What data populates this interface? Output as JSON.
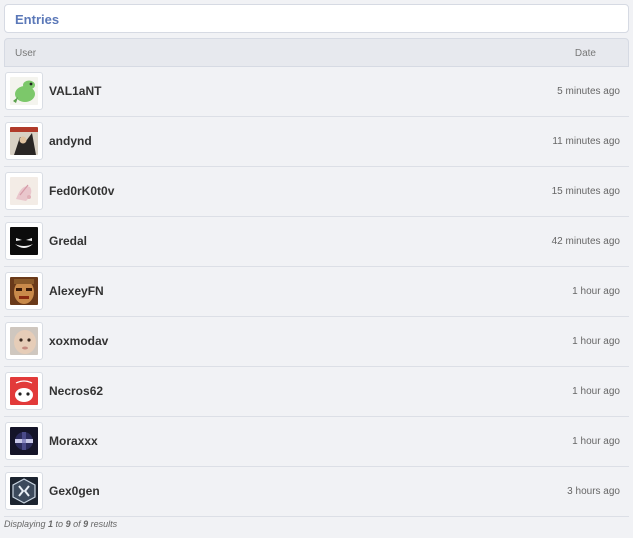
{
  "header": {
    "title": "Entries"
  },
  "table": {
    "columns": {
      "user": "User",
      "date": "Date"
    },
    "rows": [
      {
        "user": "VAL1aNT",
        "time": "5 minutes ago",
        "avatar": "green-creature-avatar"
      },
      {
        "user": "andynd",
        "time": "11 minutes ago",
        "avatar": "dark-comic-avatar"
      },
      {
        "user": "Fed0rK0t0v",
        "time": "15 minutes ago",
        "avatar": "pale-drawing-avatar"
      },
      {
        "user": "Gredal",
        "time": "42 minutes ago",
        "avatar": "grin-face-avatar"
      },
      {
        "user": "AlexeyFN",
        "time": "1 hour ago",
        "avatar": "doom-face-avatar"
      },
      {
        "user": "xoxmodav",
        "time": "1 hour ago",
        "avatar": "baby-photo-avatar"
      },
      {
        "user": "Necros62",
        "time": "1 hour ago",
        "avatar": "red-cartoon-avatar"
      },
      {
        "user": "Moraxxx",
        "time": "1 hour ago",
        "avatar": "dark-logo-avatar"
      },
      {
        "user": "Gex0gen",
        "time": "3 hours ago",
        "avatar": "hex-emblem-avatar"
      }
    ]
  },
  "footer": {
    "prefix": "Displaying ",
    "from": "1",
    "to_word": " to ",
    "to": "9",
    "of_word": " of ",
    "total": "9",
    "suffix": " results"
  }
}
